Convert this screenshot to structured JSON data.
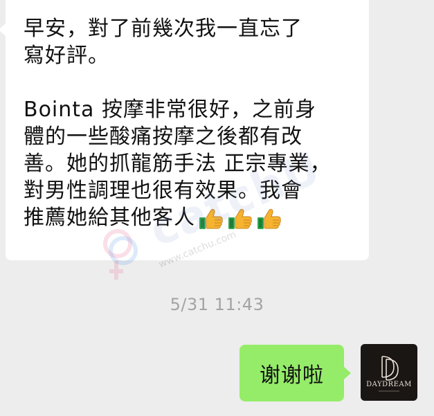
{
  "chat": {
    "incoming": {
      "lines": [
        "早安，對了前幾次我一直忘了",
        "寫好評。",
        "",
        "Bointa 按摩非常很好，之前身",
        "體的一些酸痛按摩之後都有改",
        "善。她的抓龍筋手法 正宗專業，",
        "對男性調理也很有效果。我會",
        "推薦她給其他客人"
      ],
      "emoji_icons": [
        "thumbs-up-icon",
        "thumbs-up-icon",
        "thumbs-up-icon"
      ]
    },
    "timestamp": "5/31 11:43",
    "outgoing": {
      "text": "谢谢啦"
    },
    "avatar": {
      "brand_text": "DAYDREAM",
      "monogram": "DD"
    }
  },
  "watermark": {
    "text": "catchU",
    "url": "www.catchu.com"
  },
  "colors": {
    "background": "#ededed",
    "incoming_bubble": "#ffffff",
    "outgoing_bubble": "#95ec69",
    "timestamp": "#a3a3a3",
    "avatar_bg": "#1a1614"
  }
}
